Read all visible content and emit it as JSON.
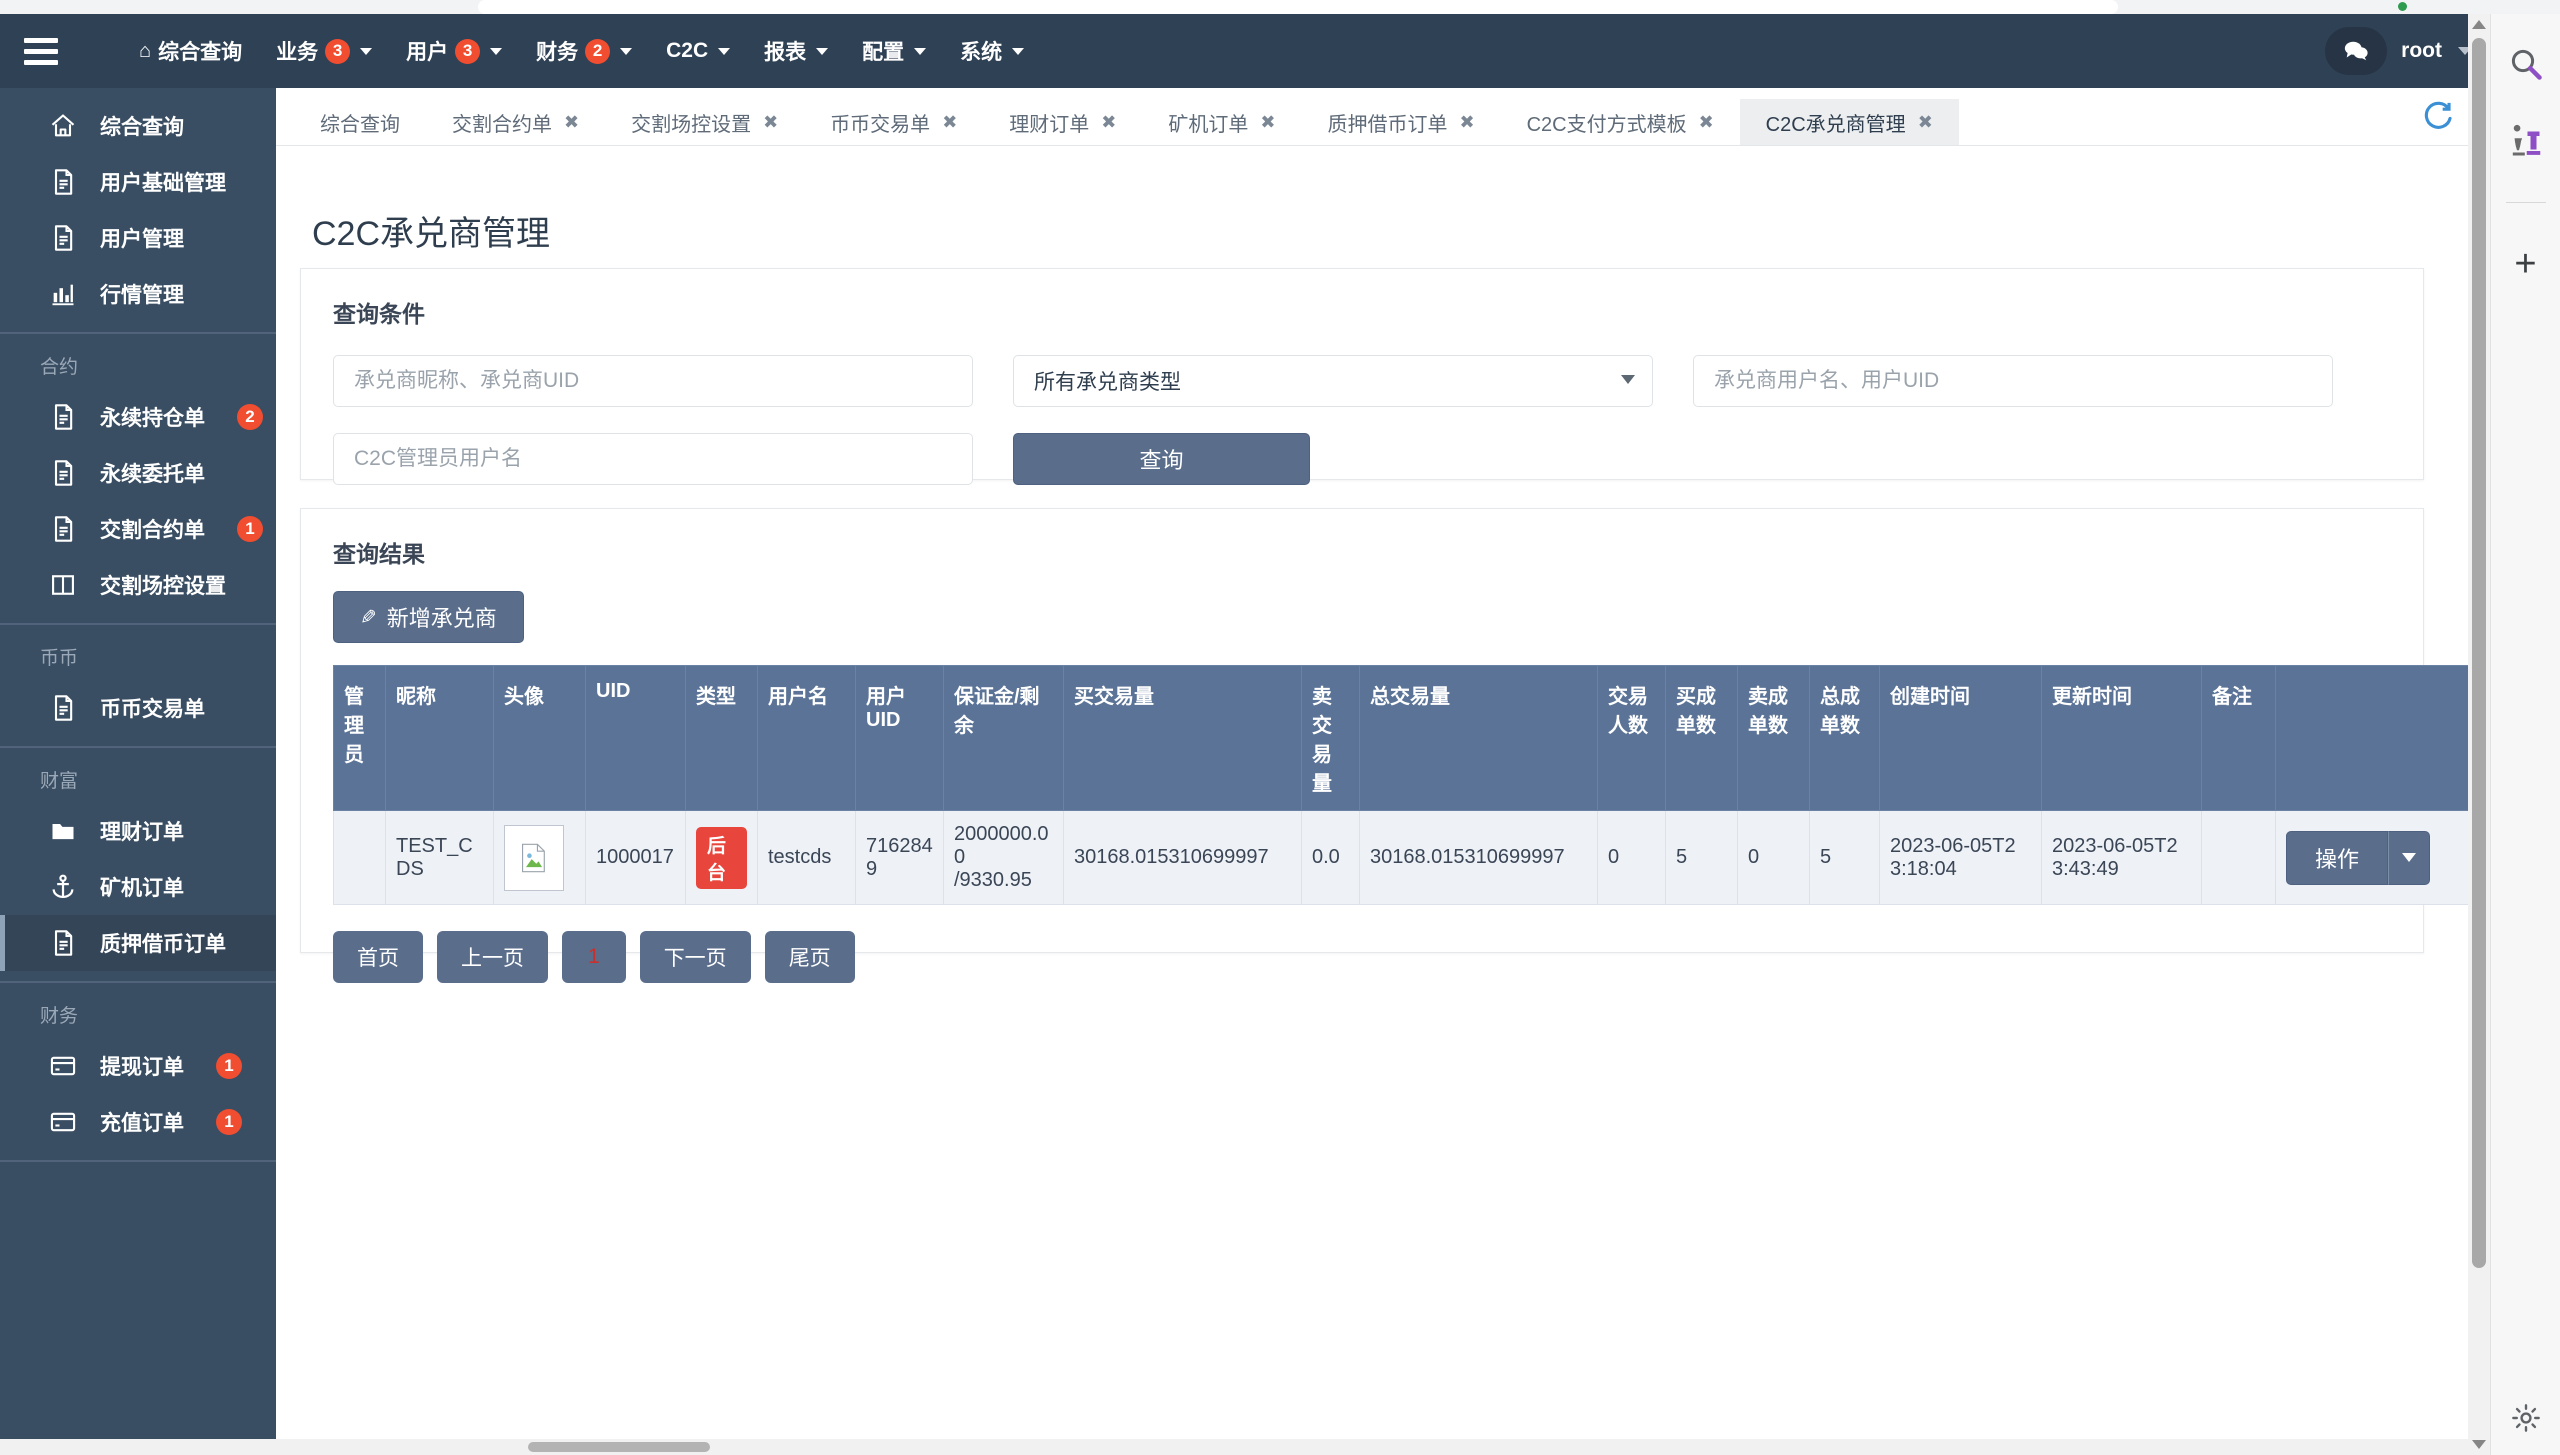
{
  "browser": {
    "status_dot_color": "#2e9b4f"
  },
  "navbar": {
    "hamburger_icon": "hamburger-menu-icon",
    "items": [
      {
        "label": "综合查询",
        "icon": "home-icon",
        "badge": "",
        "has_caret": false
      },
      {
        "label": "业务",
        "icon": "",
        "badge": "3",
        "has_caret": true
      },
      {
        "label": "用户",
        "icon": "",
        "badge": "3",
        "has_caret": true
      },
      {
        "label": "财务",
        "icon": "",
        "badge": "2",
        "has_caret": true
      },
      {
        "label": "C2C",
        "icon": "",
        "badge": "",
        "has_caret": true
      },
      {
        "label": "报表",
        "icon": "",
        "badge": "",
        "has_caret": true
      },
      {
        "label": "配置",
        "icon": "",
        "badge": "",
        "has_caret": true
      },
      {
        "label": "系统",
        "icon": "",
        "badge": "",
        "has_caret": true
      }
    ],
    "chat_icon": "chat-bubble-icon",
    "user": "root",
    "badge_color": "#f14d30"
  },
  "sidebar": {
    "groups": [
      {
        "title": "",
        "items": [
          {
            "label": "综合查询",
            "icon": "home-icon",
            "badge": "",
            "active": false
          },
          {
            "label": "用户基础管理",
            "icon": "document-icon",
            "badge": "",
            "active": false
          },
          {
            "label": "用户管理",
            "icon": "document-icon",
            "badge": "",
            "active": false
          },
          {
            "label": "行情管理",
            "icon": "bar-chart-icon",
            "badge": "",
            "active": false
          }
        ]
      },
      {
        "title": "合约",
        "items": [
          {
            "label": "永续持仓单",
            "icon": "document-icon",
            "badge": "2",
            "active": false
          },
          {
            "label": "永续委托单",
            "icon": "document-icon",
            "badge": "",
            "active": false
          },
          {
            "label": "交割合约单",
            "icon": "document-icon",
            "badge": "1",
            "active": false
          },
          {
            "label": "交割场控设置",
            "icon": "columns-icon",
            "badge": "",
            "active": false
          }
        ]
      },
      {
        "title": "币币",
        "items": [
          {
            "label": "币币交易单",
            "icon": "document-icon",
            "badge": "",
            "active": false
          }
        ]
      },
      {
        "title": "财富",
        "items": [
          {
            "label": "理财订单",
            "icon": "folder-icon",
            "badge": "",
            "active": false
          },
          {
            "label": "矿机订单",
            "icon": "anchor-icon",
            "badge": "",
            "active": false
          },
          {
            "label": "质押借币订单",
            "icon": "document-icon",
            "badge": "",
            "active": true
          }
        ]
      },
      {
        "title": "财务",
        "items": [
          {
            "label": "提现订单",
            "icon": "credit-card-icon",
            "badge": "1",
            "active": false
          },
          {
            "label": "充值订单",
            "icon": "credit-card-icon",
            "badge": "1",
            "active": false
          }
        ]
      }
    ]
  },
  "tabs": {
    "items": [
      {
        "label": "综合查询",
        "closable": false,
        "active": false
      },
      {
        "label": "交割合约单",
        "closable": true,
        "active": false
      },
      {
        "label": "交割场控设置",
        "closable": true,
        "active": false
      },
      {
        "label": "币币交易单",
        "closable": true,
        "active": false
      },
      {
        "label": "理财订单",
        "closable": true,
        "active": false
      },
      {
        "label": "矿机订单",
        "closable": true,
        "active": false
      },
      {
        "label": "质押借币订单",
        "closable": true,
        "active": false
      },
      {
        "label": "C2C支付方式模板",
        "closable": true,
        "active": false
      },
      {
        "label": "C2C承兑商管理",
        "closable": true,
        "active": true
      }
    ],
    "close_glyph": "✖",
    "refresh_icon": "refresh-icon"
  },
  "page": {
    "title": "C2C承兑商管理"
  },
  "query_panel": {
    "heading": "查询条件",
    "merchant_placeholder": "承兑商昵称、承兑商UID",
    "merchant_value": "",
    "type_select_value": "所有承兑商类型",
    "type_select_options": [
      "所有承兑商类型"
    ],
    "user_placeholder": "承兑商用户名、用户UID",
    "user_value": "",
    "admin_placeholder": "C2C管理员用户名",
    "admin_value": "",
    "query_button": "查询"
  },
  "result_panel": {
    "heading": "查询结果",
    "add_button": "新增承兑商",
    "add_icon": "pencil-icon",
    "columns": [
      "管理员",
      "昵称",
      "头像",
      "UID",
      "类型",
      "用户名",
      "用户UID",
      "保证金/剩余",
      "买交易量",
      "卖交易量",
      "总交易量",
      "交易人数",
      "买成单数",
      "卖成单数",
      "总成单数",
      "创建时间",
      "更新时间",
      "备注",
      ""
    ],
    "rows": [
      {
        "admin": "",
        "nickname": "TEST_CDS",
        "avatar_icon": "broken-image-icon",
        "uid": "1000017",
        "type_badge": "后台",
        "username": "testcds",
        "user_uid": "7162849",
        "margin": "2000000.00",
        "margin_remain": "/9330.95",
        "buy_volume": "30168.015310699997",
        "sell_volume": "0.0",
        "total_volume": "30168.015310699997",
        "trade_people": "0",
        "buy_orders": "5",
        "sell_orders": "0",
        "total_orders": "5",
        "created_at": "2023-06-05T23:18:04",
        "updated_at": "2023-06-05T23:43:49",
        "remark": "",
        "action_label": "操作"
      }
    ],
    "type_badge_color": "#e8453c"
  },
  "pagination": {
    "first": "首页",
    "prev": "上一页",
    "current": "1",
    "next": "下一页",
    "last": "尾页",
    "current_color": "#c9302c"
  },
  "right_rail": {
    "icons": [
      "search-icon",
      "chess-pieces-icon",
      "plus-icon",
      "gear-icon"
    ]
  }
}
